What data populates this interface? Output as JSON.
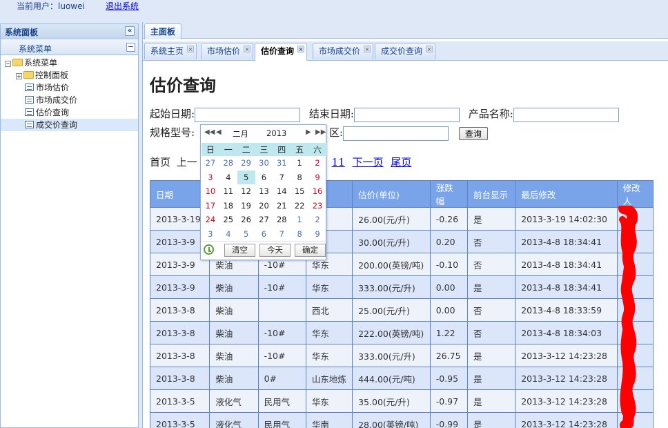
{
  "topbar": {
    "user_label": "当前用户：",
    "username": "luowei",
    "logout": "退出系统"
  },
  "sidebar": {
    "title": "系统面板",
    "menu_header": "系统菜单",
    "tree": {
      "root": "系统菜单",
      "items": [
        "控制面板",
        "市场估价",
        "市场成交价",
        "估价查询",
        "成交价查询"
      ]
    }
  },
  "main_tab": "主面板",
  "tabs": [
    "系统主页",
    "市场估价",
    "估价查询",
    "市场成交价",
    "成交价查询"
  ],
  "page": {
    "title": "估价查询",
    "start_date_label": "起始日期:",
    "end_date_label": "结束日期:",
    "product_label": "产品名称:",
    "spec_label": "规格型号:",
    "region_label": "区:",
    "query_button": "查询"
  },
  "pager": {
    "first": "首页",
    "prev_partial": "上一",
    "page_num": "11",
    "next": "下一页",
    "last": "尾页"
  },
  "calendar": {
    "month": "二月",
    "year": "2013",
    "weekdays": [
      "日",
      "一",
      "二",
      "三",
      "四",
      "五",
      "六"
    ],
    "weeks": [
      [
        "27",
        "28",
        "29",
        "30",
        "31",
        "1",
        "2"
      ],
      [
        "3",
        "4",
        "5",
        "6",
        "7",
        "8",
        "9"
      ],
      [
        "10",
        "11",
        "12",
        "13",
        "14",
        "15",
        "16"
      ],
      [
        "17",
        "18",
        "19",
        "20",
        "21",
        "22",
        "23"
      ],
      [
        "24",
        "25",
        "26",
        "27",
        "28",
        "1",
        "2"
      ],
      [
        "3",
        "4",
        "5",
        "6",
        "7",
        "8",
        "9"
      ]
    ],
    "clear": "清空",
    "today": "今天",
    "ok": "确定"
  },
  "table": {
    "headers": [
      "日期",
      "",
      "",
      "",
      "估价(单位)",
      "涨跌幅",
      "前台显示",
      "最后修改",
      "修改人"
    ],
    "rows": [
      [
        "2013-3-19",
        "",
        "",
        "",
        "26.00(元/升)",
        "-0.26",
        "是",
        "2013-3-19 14:02:30"
      ],
      [
        "2013-3-9",
        "",
        "",
        "",
        "30.00(元/升)",
        "0.20",
        "否",
        "2013-4-8 18:34:41"
      ],
      [
        "2013-3-9",
        "柴油",
        "-10#",
        "华东",
        "200.00(英镑/吨)",
        "-0.10",
        "否",
        "2013-4-8 18:34:41"
      ],
      [
        "2013-3-9",
        "柴油",
        "-10#",
        "华东",
        "333.00(元/升)",
        "0.00",
        "是",
        "2013-4-8 18:34:41"
      ],
      [
        "2013-3-8",
        "柴油",
        "",
        "西北",
        "25.00(元/升)",
        "0.00",
        "否",
        "2013-4-8 18:33:59"
      ],
      [
        "2013-3-8",
        "柴油",
        "-10#",
        "华东",
        "222.00(英镑/吨)",
        "1.22",
        "否",
        "2013-4-8 18:34:03"
      ],
      [
        "2013-3-8",
        "柴油",
        "-10#",
        "华东",
        "333.00(元/升)",
        "26.75",
        "是",
        "2013-3-12 14:23:28"
      ],
      [
        "2013-3-8",
        "柴油",
        "0#",
        "山东地炼",
        "444.00(元/吨)",
        "-0.95",
        "是",
        "2013-3-12 14:23:28"
      ],
      [
        "2013-3-5",
        "液化气",
        "民用气",
        "华东",
        "35.00(元/升)",
        "-0.97",
        "是",
        "2013-3-12 14:23:28"
      ],
      [
        "2013-3-5",
        "液化气",
        "民用气",
        "华南",
        "28.00(英镑/吨)",
        "-0.99",
        "是",
        "2013-3-12 14:23:28"
      ]
    ]
  }
}
